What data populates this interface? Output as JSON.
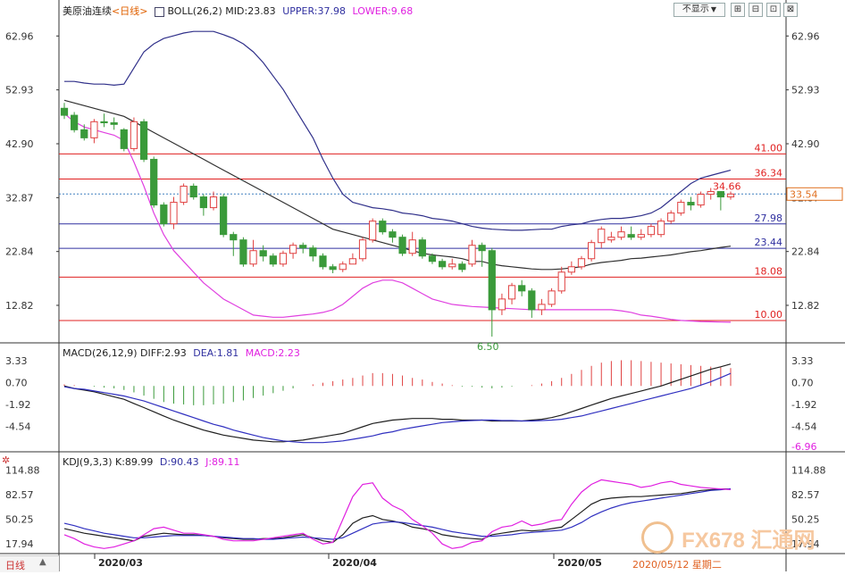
{
  "legend_main": {
    "title": "美原油连续",
    "period": "<日线>",
    "indicator": "BOLL(26,2)",
    "mid": "MID:23.83",
    "upper": "UPPER:37.98",
    "lower": "LOWER:9.68"
  },
  "legend_macd": {
    "title": "MACD(26,12,9)",
    "diff": "DIFF:2.93",
    "dea": "DEA:1.81",
    "macd": "MACD:2.23"
  },
  "legend_kdj": {
    "title": "KDJ(9,3,3)",
    "k": "K:89.99",
    "d": "D:90.43",
    "j": "J:89.11"
  },
  "toolbar": {
    "hide_label": "不显示",
    "period_label": "日线"
  },
  "xaxis": {
    "labels": [
      "2020/03",
      "2020/04",
      "2020/05"
    ],
    "date_tag": "2020/05/12 星期二"
  },
  "watermark": "FX678 汇通网",
  "colors": {
    "up": "#e04040",
    "down": "#3a9a3a",
    "upper": "#30308a",
    "mid": "#303030",
    "lower": "#e040e0",
    "diff": "#202020",
    "dea": "#3030c0",
    "k": "#202020",
    "d": "#3030c0",
    "j": "#e020e0",
    "hline_red": "#e02020",
    "hline_blue": "#3030a0"
  },
  "chart_data": [
    {
      "type": "candlestick",
      "title": "美原油连续",
      "ylim": [
        6.5,
        66
      ],
      "yticks": [
        62.96,
        52.93,
        42.9,
        32.87,
        22.84,
        12.82
      ],
      "last_price_label": "33.54",
      "hlines": [
        {
          "value": 41.0,
          "label": "41.00",
          "color": "red"
        },
        {
          "value": 36.34,
          "label": "36.34",
          "color": "red"
        },
        {
          "value": 27.98,
          "label": "27.98",
          "color": "blue"
        },
        {
          "value": 23.44,
          "label": "23.44",
          "color": "blue"
        },
        {
          "value": 18.08,
          "label": "18.08",
          "color": "red"
        },
        {
          "value": 10.0,
          "label": "10.00",
          "color": "red"
        }
      ],
      "annotations": [
        {
          "x": 38,
          "y": 34.66,
          "text": "34.66",
          "color": "red"
        },
        {
          "x": 38,
          "y": 6.5,
          "text": "6.50",
          "color": "green"
        }
      ],
      "candles": [
        [
          49.5,
          48.2,
          50.5,
          47.5
        ],
        [
          48.2,
          45.5,
          48.8,
          45.0
        ],
        [
          45.5,
          44.0,
          46.5,
          43.5
        ],
        [
          44.0,
          47.0,
          47.5,
          43.0
        ],
        [
          47.0,
          46.8,
          48.5,
          46.0
        ],
        [
          46.8,
          46.5,
          47.8,
          45.5
        ],
        [
          45.5,
          42.0,
          45.8,
          41.5
        ],
        [
          42.0,
          47.0,
          47.8,
          41.5
        ],
        [
          47.0,
          40.0,
          47.5,
          39.5
        ],
        [
          40.0,
          31.5,
          40.5,
          31.0
        ],
        [
          31.5,
          28.0,
          32.0,
          27.5
        ],
        [
          28.0,
          32.0,
          33.0,
          27.0
        ],
        [
          32.0,
          35.0,
          35.5,
          31.5
        ],
        [
          35.0,
          33.0,
          35.5,
          32.5
        ],
        [
          33.0,
          31.0,
          33.5,
          29.5
        ],
        [
          31.0,
          33.0,
          34.0,
          30.5
        ],
        [
          33.0,
          26.0,
          33.5,
          25.5
        ],
        [
          26.0,
          25.0,
          26.5,
          22.0
        ],
        [
          25.0,
          20.5,
          25.5,
          20.0
        ],
        [
          20.5,
          23.0,
          25.0,
          20.0
        ],
        [
          23.0,
          22.0,
          24.0,
          21.0
        ],
        [
          22.0,
          20.5,
          22.5,
          20.0
        ],
        [
          20.5,
          22.5,
          23.0,
          20.0
        ],
        [
          22.5,
          24.0,
          24.5,
          21.5
        ],
        [
          24.0,
          23.5,
          24.5,
          22.5
        ],
        [
          23.5,
          22.0,
          24.0,
          21.0
        ],
        [
          22.0,
          20.0,
          22.5,
          19.5
        ],
        [
          20.0,
          19.5,
          20.5,
          18.8
        ],
        [
          19.5,
          20.5,
          21.0,
          19.0
        ],
        [
          20.5,
          21.5,
          22.5,
          20.5
        ],
        [
          21.5,
          25.0,
          25.5,
          21.0
        ],
        [
          25.0,
          28.5,
          29.0,
          24.5
        ],
        [
          28.5,
          26.5,
          29.0,
          26.0
        ],
        [
          26.5,
          25.5,
          27.0,
          24.5
        ],
        [
          25.5,
          22.5,
          26.0,
          22.0
        ],
        [
          22.5,
          25.0,
          26.5,
          22.0
        ],
        [
          25.0,
          22.0,
          25.5,
          21.5
        ],
        [
          22.0,
          21.0,
          22.5,
          20.5
        ],
        [
          21.0,
          20.0,
          21.5,
          19.5
        ],
        [
          20.0,
          20.5,
          21.5,
          19.5
        ],
        [
          20.5,
          19.5,
          21.0,
          19.0
        ],
        [
          20.5,
          24.0,
          25.0,
          20.0
        ],
        [
          24.0,
          23.0,
          24.5,
          20.0
        ],
        [
          23.0,
          12.0,
          23.5,
          7.0
        ],
        [
          12.0,
          14.0,
          15.0,
          11.0
        ],
        [
          14.0,
          16.5,
          17.0,
          13.0
        ],
        [
          16.5,
          15.5,
          17.5,
          14.5
        ],
        [
          15.5,
          12.0,
          16.0,
          10.5
        ],
        [
          12.0,
          13.0,
          14.0,
          11.0
        ],
        [
          13.0,
          15.5,
          16.0,
          12.5
        ],
        [
          15.5,
          19.0,
          20.0,
          15.0
        ],
        [
          19.0,
          20.0,
          21.0,
          18.5
        ],
        [
          20.0,
          21.5,
          22.0,
          19.5
        ],
        [
          21.5,
          24.5,
          25.0,
          21.0
        ],
        [
          24.5,
          27.0,
          27.5,
          23.5
        ],
        [
          25.0,
          25.5,
          26.5,
          24.5
        ],
        [
          25.5,
          26.5,
          27.5,
          25.0
        ],
        [
          26.0,
          25.5,
          27.5,
          25.0
        ],
        [
          25.5,
          26.0,
          27.0,
          25.0
        ],
        [
          26.0,
          27.5,
          28.0,
          25.5
        ],
        [
          26.0,
          28.5,
          29.0,
          25.5
        ],
        [
          28.5,
          30.0,
          30.5,
          28.0
        ],
        [
          30.0,
          32.0,
          32.5,
          29.5
        ],
        [
          32.0,
          31.5,
          33.0,
          30.5
        ],
        [
          31.5,
          33.5,
          34.0,
          31.0
        ],
        [
          33.5,
          34.0,
          34.66,
          32.5
        ],
        [
          34.0,
          33.0,
          34.0,
          30.5
        ],
        [
          33.0,
          33.54,
          34.0,
          32.5
        ]
      ],
      "series": [
        {
          "name": "UPPER",
          "values": [
            54.5,
            54.5,
            54.2,
            54.0,
            54.0,
            53.8,
            54.0,
            57.0,
            60.0,
            61.5,
            62.5,
            63.0,
            63.5,
            63.8,
            63.8,
            63.8,
            63.2,
            62.5,
            61.5,
            60.0,
            58.0,
            55.5,
            53.0,
            50.0,
            47.0,
            44.0,
            40.0,
            36.5,
            33.5,
            32.0,
            31.5,
            31.0,
            30.8,
            30.5,
            30.0,
            29.8,
            29.5,
            29.0,
            28.8,
            28.5,
            28.0,
            27.5,
            27.2,
            27.0,
            26.9,
            26.8,
            26.8,
            26.9,
            27.0,
            27.0,
            27.5,
            27.8,
            28.0,
            28.5,
            28.8,
            29.0,
            29.0,
            29.2,
            29.5,
            30.0,
            31.0,
            32.5,
            34.0,
            35.5,
            36.5,
            37.0,
            37.5,
            37.98
          ]
        },
        {
          "name": "MID",
          "values": [
            51.0,
            50.5,
            50.0,
            49.5,
            49.0,
            48.5,
            48.0,
            47.0,
            46.0,
            45.0,
            44.0,
            43.0,
            42.0,
            41.0,
            40.0,
            39.0,
            38.0,
            37.0,
            36.0,
            35.0,
            34.0,
            33.0,
            32.0,
            31.0,
            30.0,
            29.0,
            28.0,
            27.0,
            26.5,
            26.0,
            25.5,
            25.0,
            24.5,
            24.0,
            23.5,
            23.0,
            22.5,
            22.2,
            22.0,
            21.8,
            21.5,
            21.0,
            21.0,
            20.5,
            20.2,
            20.0,
            19.8,
            19.6,
            19.5,
            19.5,
            19.6,
            19.8,
            20.0,
            20.5,
            20.8,
            21.0,
            21.2,
            21.5,
            21.6,
            21.8,
            22.0,
            22.2,
            22.5,
            22.8,
            23.0,
            23.3,
            23.6,
            23.83
          ]
        },
        {
          "name": "LOWER",
          "values": [
            48.5,
            47.0,
            46.0,
            45.5,
            45.0,
            44.5,
            43.5,
            39.5,
            35.0,
            30.0,
            26.0,
            23.0,
            21.0,
            19.0,
            17.0,
            15.5,
            14.0,
            13.0,
            12.0,
            11.0,
            10.8,
            10.6,
            10.6,
            10.8,
            11.0,
            11.2,
            11.5,
            12.0,
            13.0,
            14.5,
            16.0,
            17.0,
            17.5,
            17.5,
            17.0,
            16.0,
            15.0,
            14.0,
            13.5,
            13.0,
            12.8,
            12.6,
            12.5,
            12.4,
            12.3,
            12.2,
            12.1,
            12.0,
            12.0,
            12.0,
            12.0,
            12.0,
            12.0,
            12.0,
            12.0,
            12.0,
            11.8,
            11.5,
            11.0,
            10.8,
            10.5,
            10.2,
            10.0,
            9.9,
            9.8,
            9.75,
            9.7,
            9.68
          ]
        }
      ]
    },
    {
      "type": "bar",
      "title": "MACD(26,12,9)",
      "ylim": [
        -6.96,
        3.33
      ],
      "yticks": [
        3.33,
        0.7,
        -1.92,
        -4.54,
        -6.96
      ],
      "series": [
        {
          "name": "MACD",
          "values": [
            0.2,
            0.1,
            0.0,
            -0.1,
            -0.2,
            -0.3,
            -0.5,
            -0.8,
            -1.2,
            -1.6,
            -2.0,
            -2.2,
            -2.3,
            -2.4,
            -2.4,
            -2.3,
            -2.2,
            -2.0,
            -1.8,
            -1.5,
            -1.2,
            -0.9,
            -0.6,
            -0.3,
            0.0,
            0.2,
            0.4,
            0.6,
            0.8,
            1.0,
            1.3,
            1.6,
            1.6,
            1.5,
            1.3,
            1.0,
            0.8,
            0.5,
            0.3,
            0.1,
            -0.1,
            -0.1,
            -0.2,
            -0.3,
            -0.2,
            -0.1,
            0.0,
            0.1,
            0.3,
            0.6,
            1.0,
            1.5,
            2.0,
            2.5,
            2.9,
            3.1,
            3.2,
            3.2,
            3.1,
            3.0,
            2.9,
            2.8,
            2.7,
            2.6,
            2.5,
            2.4,
            2.3,
            2.23
          ]
        },
        {
          "name": "DIFF",
          "values": [
            0.3,
            0.0,
            -0.2,
            -0.4,
            -0.7,
            -1.0,
            -1.3,
            -1.8,
            -2.3,
            -2.8,
            -3.3,
            -3.8,
            -4.2,
            -4.6,
            -5.0,
            -5.3,
            -5.6,
            -5.8,
            -6.0,
            -6.2,
            -6.3,
            -6.4,
            -6.4,
            -6.3,
            -6.2,
            -6.0,
            -5.8,
            -5.6,
            -5.4,
            -5.0,
            -4.6,
            -4.2,
            -4.0,
            -3.8,
            -3.7,
            -3.6,
            -3.6,
            -3.6,
            -3.7,
            -3.7,
            -3.8,
            -3.8,
            -3.8,
            -3.9,
            -3.9,
            -3.9,
            -3.9,
            -3.8,
            -3.7,
            -3.5,
            -3.2,
            -2.8,
            -2.4,
            -2.0,
            -1.6,
            -1.2,
            -0.9,
            -0.6,
            -0.3,
            0.0,
            0.3,
            0.7,
            1.1,
            1.5,
            1.9,
            2.3,
            2.6,
            2.93
          ]
        },
        {
          "name": "DEA",
          "values": [
            0.2,
            0.0,
            -0.1,
            -0.3,
            -0.5,
            -0.7,
            -0.9,
            -1.2,
            -1.5,
            -1.9,
            -2.3,
            -2.7,
            -3.1,
            -3.5,
            -3.9,
            -4.3,
            -4.6,
            -5.0,
            -5.3,
            -5.6,
            -5.9,
            -6.1,
            -6.3,
            -6.4,
            -6.5,
            -6.5,
            -6.5,
            -6.4,
            -6.3,
            -6.1,
            -5.9,
            -5.7,
            -5.4,
            -5.2,
            -4.9,
            -4.7,
            -4.5,
            -4.3,
            -4.1,
            -4.0,
            -3.9,
            -3.85,
            -3.8,
            -3.8,
            -3.85,
            -3.85,
            -3.9,
            -3.9,
            -3.85,
            -3.8,
            -3.7,
            -3.5,
            -3.3,
            -3.0,
            -2.7,
            -2.4,
            -2.1,
            -1.8,
            -1.5,
            -1.2,
            -0.9,
            -0.6,
            -0.3,
            0.0,
            0.4,
            0.8,
            1.3,
            1.81
          ]
        }
      ]
    },
    {
      "type": "line",
      "title": "KDJ(9,3,3)",
      "ylim": [
        10,
        120
      ],
      "yticks": [
        114.88,
        82.57,
        50.25,
        17.94
      ],
      "series": [
        {
          "name": "K",
          "values": [
            38,
            35,
            32,
            30,
            28,
            26,
            24,
            22,
            28,
            30,
            32,
            31,
            30,
            30,
            29,
            28,
            26,
            25,
            24,
            24,
            25,
            25,
            26,
            28,
            30,
            26,
            22,
            20,
            30,
            45,
            52,
            55,
            50,
            48,
            45,
            40,
            38,
            35,
            30,
            28,
            26,
            25,
            24,
            30,
            32,
            34,
            36,
            35,
            36,
            38,
            40,
            50,
            60,
            70,
            76,
            78,
            79,
            80,
            80,
            81,
            82,
            83,
            84,
            86,
            88,
            89,
            90,
            89.99
          ]
        },
        {
          "name": "D",
          "values": [
            45,
            42,
            38,
            35,
            32,
            30,
            28,
            26,
            26,
            27,
            28,
            29,
            29,
            29,
            29,
            28,
            27,
            26,
            25,
            25,
            24,
            24,
            25,
            26,
            27,
            26,
            25,
            24,
            26,
            32,
            38,
            44,
            46,
            47,
            46,
            44,
            42,
            40,
            37,
            34,
            32,
            30,
            28,
            28,
            29,
            30,
            32,
            33,
            34,
            35,
            36,
            40,
            46,
            54,
            60,
            65,
            69,
            72,
            74,
            76,
            78,
            80,
            82,
            84,
            86,
            88,
            89,
            90.43
          ]
        },
        {
          "name": "J",
          "values": [
            30,
            25,
            18,
            14,
            12,
            14,
            18,
            22,
            30,
            38,
            40,
            36,
            32,
            32,
            30,
            28,
            24,
            22,
            22,
            22,
            24,
            26,
            28,
            30,
            32,
            24,
            18,
            20,
            50,
            80,
            96,
            98,
            78,
            68,
            62,
            50,
            42,
            32,
            18,
            12,
            14,
            20,
            22,
            34,
            40,
            42,
            48,
            42,
            44,
            48,
            50,
            70,
            86,
            96,
            102,
            100,
            98,
            96,
            92,
            94,
            98,
            100,
            96,
            94,
            92,
            91,
            90,
            89.11
          ]
        }
      ]
    }
  ]
}
